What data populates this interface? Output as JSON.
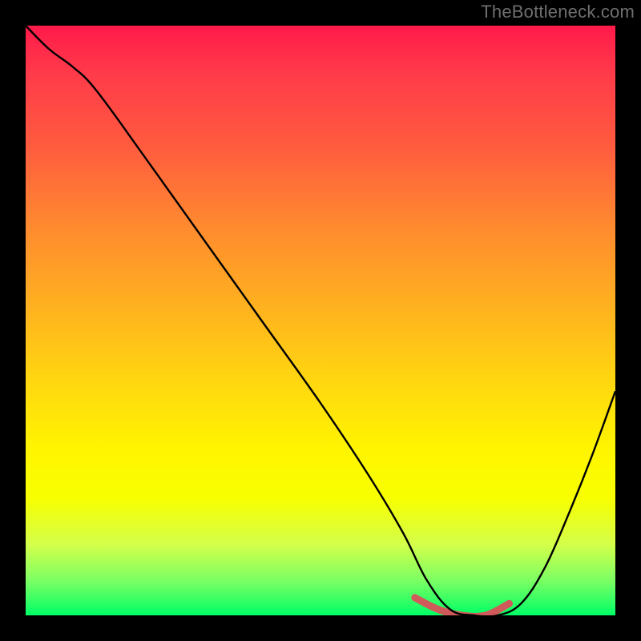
{
  "watermark": "TheBottleneck.com",
  "chart_data": {
    "type": "line",
    "title": "",
    "xlabel": "",
    "ylabel": "",
    "xlim": [
      0,
      100
    ],
    "ylim": [
      0,
      100
    ],
    "grid": false,
    "legend": false,
    "background": {
      "kind": "vertical-gradient",
      "stops": [
        {
          "pos": 0,
          "color": "#ff1a4a"
        },
        {
          "pos": 20,
          "color": "#ff5a3f"
        },
        {
          "pos": 48,
          "color": "#ffb21f"
        },
        {
          "pos": 72,
          "color": "#fff500"
        },
        {
          "pos": 94,
          "color": "#7dff63"
        },
        {
          "pos": 100,
          "color": "#00ff66"
        }
      ]
    },
    "series": [
      {
        "name": "bottleneck-curve",
        "color": "#000000",
        "x": [
          0,
          4,
          8,
          12,
          20,
          30,
          40,
          50,
          58,
          64,
          68,
          72,
          76,
          80,
          84,
          88,
          92,
          96,
          100
        ],
        "y": [
          100,
          96,
          93,
          89,
          78,
          64,
          50,
          36,
          24,
          14,
          6,
          1,
          0,
          0,
          2,
          8,
          17,
          27,
          38
        ]
      }
    ],
    "highlight": {
      "name": "valley-marker",
      "color": "#d05a5a",
      "x": [
        66,
        70,
        74,
        78,
        82
      ],
      "y": [
        3,
        1,
        0,
        0,
        2
      ]
    }
  }
}
